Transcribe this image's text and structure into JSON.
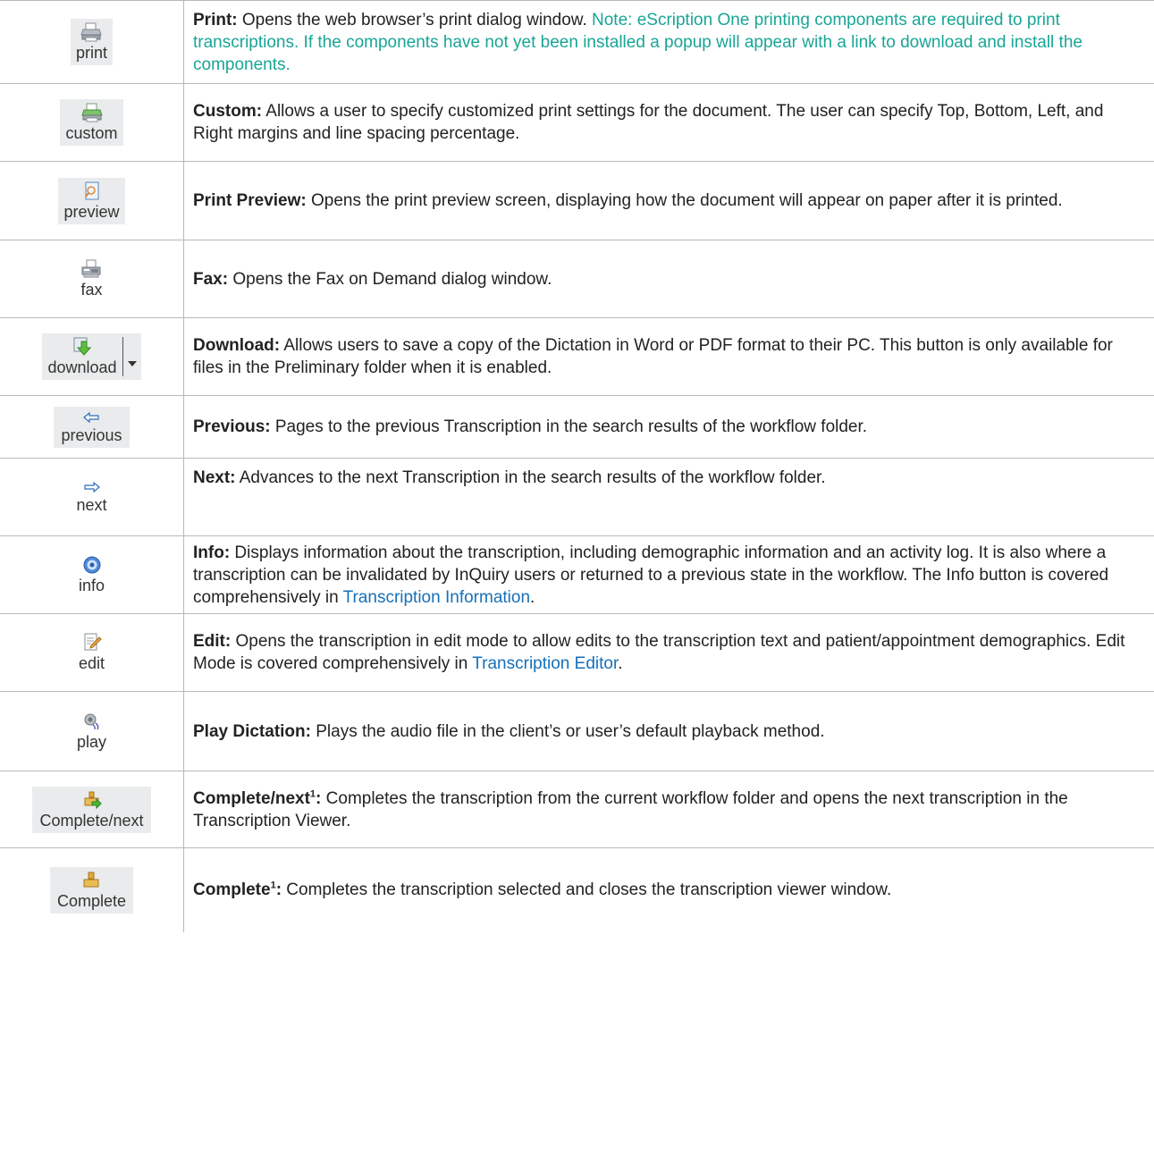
{
  "rows": [
    {
      "icon": "printer-icon",
      "button_label": "print",
      "title": "Print:",
      "text": "  Opens the web browser’s print dialog window. ",
      "note": "Note: eScription One printing components are required to print transcriptions. If the components have not yet been installed a popup will appear with a link to download and install the components",
      "after": "."
    },
    {
      "icon": "custom-print-icon",
      "button_label": "custom",
      "title": "Custom:",
      "text": "  Allows a user to specify customized print settings for the document. The user can specify Top, Bottom, Left, and Right margins and line spacing percentage."
    },
    {
      "icon": "preview-icon",
      "button_label": "preview",
      "title": "Print Preview:",
      "text": "  Opens the print preview screen, displaying how the document will appear on paper after it is printed."
    },
    {
      "icon": "fax-icon",
      "button_label": "fax",
      "title": "Fax:",
      "text": "  Opens the Fax on Demand dialog window."
    },
    {
      "icon": "download-icon",
      "button_label": "download",
      "title": "Download:",
      "text": " Allows users to save a copy of the Dictation in Word or PDF format to their PC. This button is only available for files in the Preliminary folder when it is enabled."
    },
    {
      "icon": "arrow-left-icon",
      "button_label": "previous",
      "title": "Previous:",
      "text": " Pages to the previous Transcription in the search results of the workflow folder."
    },
    {
      "icon": "arrow-right-icon",
      "button_label": "next",
      "title": "Next:",
      "text": " Advances to the next Transcription in the search results of the workflow folder."
    },
    {
      "icon": "info-icon",
      "button_label": "info",
      "title": "Info:",
      "text": " Displays information about the transcription, including demographic information and an activity log. It is also where a transcription can be invalidated by InQuiry users or returned to a previous state in the workflow. The Info button is covered comprehensively in ",
      "link": "Transcription Information",
      "after": "."
    },
    {
      "icon": "edit-icon",
      "button_label": "edit",
      "title": "Edit:",
      "text": " Opens the transcription in edit mode to allow edits to the transcription text and patient/appointment demographics. Edit Mode is covered comprehensively in ",
      "link": "Transcription Editor",
      "after": "."
    },
    {
      "icon": "speaker-icon",
      "button_label": "play",
      "title": "Play Dictation:",
      "text": " Plays the audio file in the client’s or user’s default playback method."
    },
    {
      "icon": "complete-next-icon",
      "button_label": "Complete/next",
      "title": "Complete/next",
      "sup": "1",
      "title_colon": ":",
      "text": " Completes the transcription from the current workflow folder and opens the next transcription in the Transcription Viewer."
    },
    {
      "icon": "complete-icon",
      "button_label": "Complete",
      "title": "Complete",
      "sup": "1",
      "title_colon": ":",
      "text": " Completes the transcription selected and closes the transcription viewer window."
    }
  ]
}
